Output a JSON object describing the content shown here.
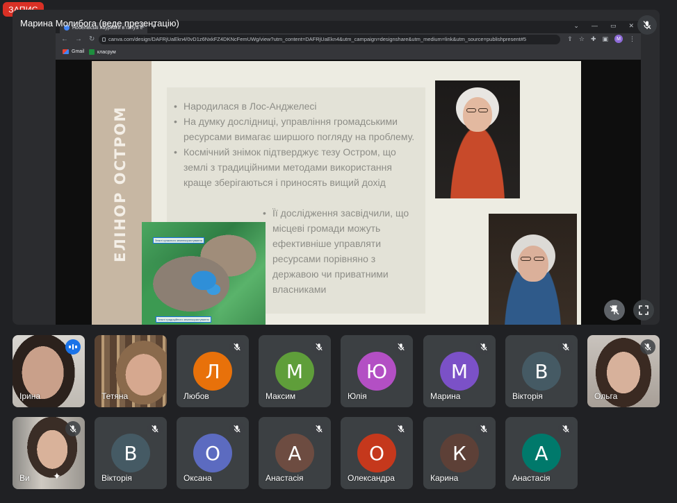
{
  "recording_badge": "ЗАПИС",
  "presenter_label": "Марина Молибога (веде презентацію)",
  "browser": {
    "tab_title": "Нобелівські лауреати в галузі е",
    "tab_close": "×",
    "new_tab": "+",
    "url": "canva.com/design/DAFRjUaEkn4/0vD1z6NxkFZ4DKNcFemUWg/view?utm_content=DAFRjUaEkn4&utm_campaign=designshare&utm_medium=link&utm_source=publishpresent#5",
    "bookmarks": [
      "Gmail",
      "класрум"
    ],
    "profile_initial": "M"
  },
  "slide": {
    "side_title": "ЕЛІНОР ОСТРОМ",
    "bullets": [
      "Народилася в Лос-Анджелесі",
      "На думку дослідниці, управління громадськими ресурсами вимагає ширшого погляду на проблему.",
      "Космічний знімок підтверджує тезу Остром, що землі з традиційними методами використання краще зберігаються і приносять вищий дохід"
    ],
    "bullets_secondary": [
      "Її дослідження засвідчили, що місцеві громади можуть ефективніше управляти ресурсами порівняно з державою чи приватними власниками"
    ],
    "map_labels": [
      "Землі сучасного землекористування",
      "Землі традиційного землекористування"
    ]
  },
  "participants": [
    {
      "name": "Ірина",
      "type": "video",
      "state": "speaking"
    },
    {
      "name": "Тетяна",
      "type": "video",
      "state": "none"
    },
    {
      "name": "Любов",
      "initial": "Л",
      "color": "#e8710a",
      "state": "muted"
    },
    {
      "name": "Максим",
      "initial": "М",
      "color": "#5f9e3a",
      "state": "muted"
    },
    {
      "name": "Юлія",
      "initial": "Ю",
      "color": "#b34fc4",
      "state": "muted"
    },
    {
      "name": "Марина",
      "initial": "М",
      "color": "#7b51c7",
      "state": "muted"
    },
    {
      "name": "Вікторія",
      "initial": "В",
      "color": "#455a64",
      "state": "muted"
    },
    {
      "name": "Ольга",
      "type": "video",
      "state": "muted"
    },
    {
      "name": "Ви",
      "type": "video",
      "state": "muted"
    },
    {
      "name": "Вікторія",
      "initial": "В",
      "color": "#455a64",
      "state": "muted"
    },
    {
      "name": "Оксана",
      "initial": "О",
      "color": "#5c6bc0",
      "state": "muted"
    },
    {
      "name": "Анастасія",
      "initial": "А",
      "color": "#6d4c41",
      "state": "muted"
    },
    {
      "name": "Олександра",
      "initial": "О",
      "color": "#c5381c",
      "state": "muted"
    },
    {
      "name": "Карина",
      "initial": "К",
      "color": "#5d4037",
      "state": "muted"
    },
    {
      "name": "Анастасія",
      "initial": "А",
      "color": "#00796b",
      "state": "muted"
    }
  ]
}
